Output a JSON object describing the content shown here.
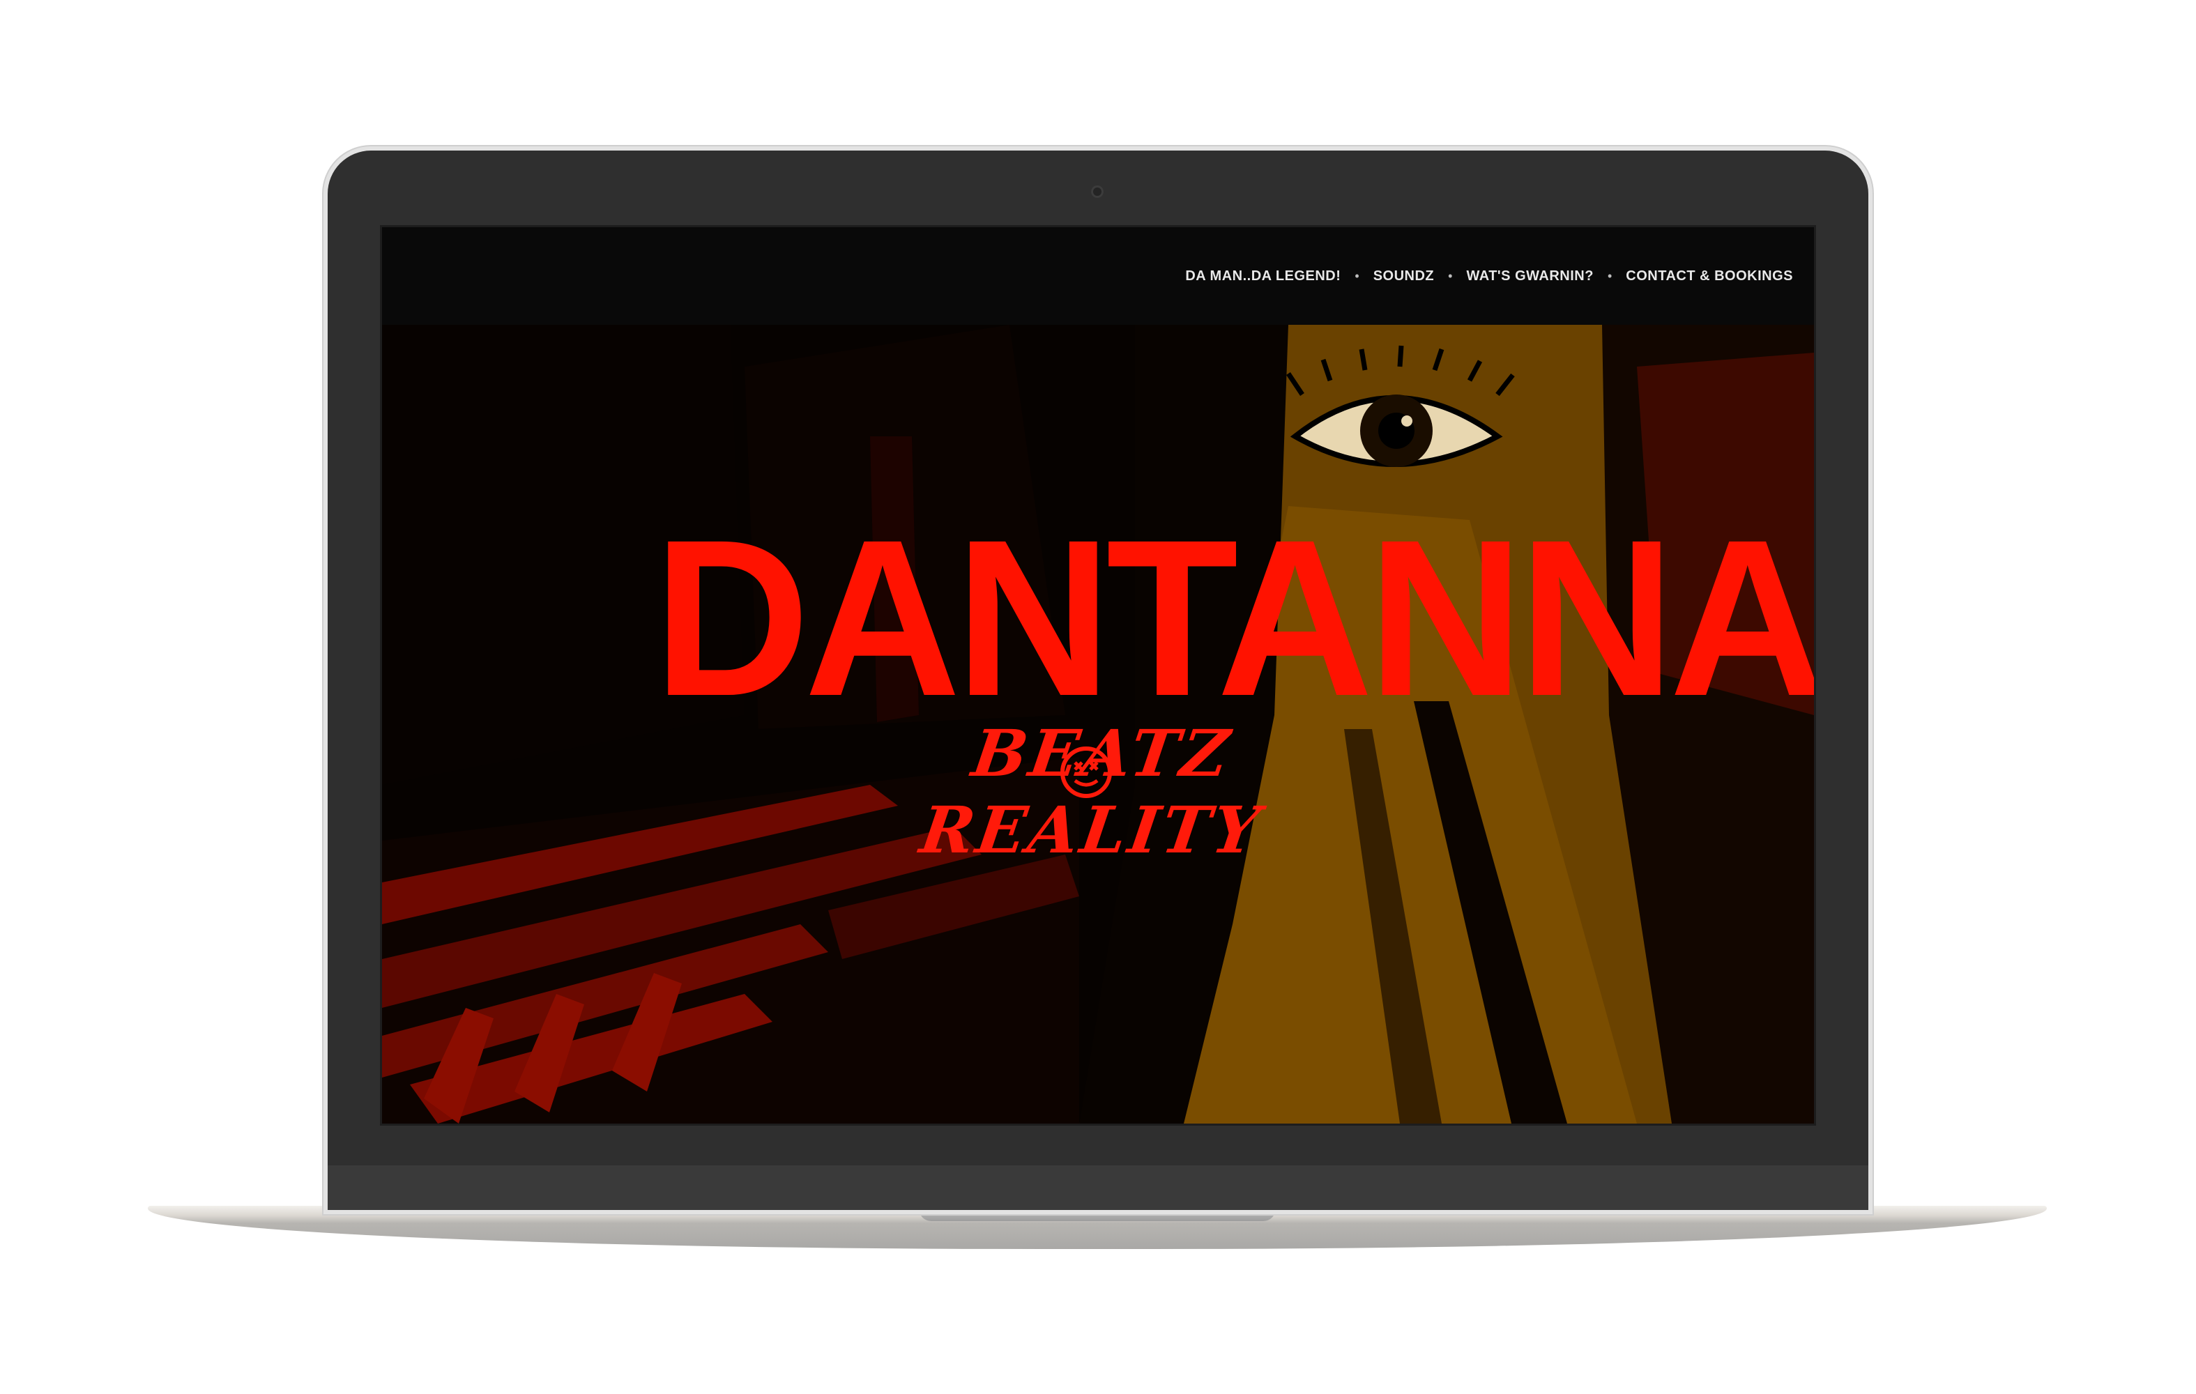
{
  "nav": {
    "items": [
      {
        "label": "DA MAN..DA LEGEND!"
      },
      {
        "label": "SOUNDZ"
      },
      {
        "label": "WAT'S GWARNIN?"
      },
      {
        "label": "CONTACT & BOOKINGS"
      }
    ],
    "separator": "•"
  },
  "hero": {
    "logo_title": "DANTANNA",
    "logo_subtitle": "BEATZ REALITY"
  },
  "colors": {
    "logo_red": "#ff1200",
    "overlay_ochre": "#6b4300",
    "street_red": "#7a0a00",
    "nav_bg": "#0a0a0a"
  },
  "icons": {
    "subtitle_emblem": "smiley-x-eyes-icon",
    "artwork_eye": "eye-icon"
  }
}
